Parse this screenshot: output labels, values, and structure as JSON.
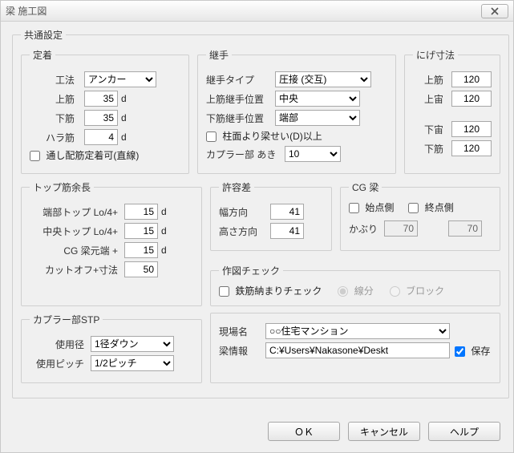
{
  "window": {
    "title": "梁 施工図"
  },
  "common": {
    "legend": "共通設定",
    "fixation": {
      "legend": "定着",
      "method_label": "工法",
      "method_value": "アンカー",
      "upper_label": "上筋",
      "upper_value": "35",
      "upper_unit": "d",
      "lower_label": "下筋",
      "lower_value": "35",
      "lower_unit": "d",
      "hara_label": "ハラ筋",
      "hara_value": "4",
      "hara_unit": "d",
      "through_label": "通し配筋定着可(直線)"
    },
    "joint": {
      "legend": "継手",
      "type_label": "継手タイプ",
      "type_value": "圧接 (交互)",
      "upper_pos_label": "上筋継手位置",
      "upper_pos_value": "中央",
      "lower_pos_label": "下筋継手位置",
      "lower_pos_value": "端部",
      "pillar_label": "柱面より梁せい(D)以上",
      "coupler_label": "カプラー部 あき",
      "coupler_value": "10"
    },
    "nige": {
      "legend": "にげ寸法",
      "upper_label": "上筋",
      "upper_value": "120",
      "upper_air_label": "上宙",
      "upper_air_value": "120",
      "lower_air_label": "下宙",
      "lower_air_value": "120",
      "lower_label": "下筋",
      "lower_value": "120"
    }
  },
  "topsuji": {
    "legend": "トップ筋余長",
    "edge_label": "端部トップ Lo/4+",
    "edge_value": "15",
    "edge_unit": "d",
    "center_label": "中央トップ Lo/4+",
    "center_value": "15",
    "center_unit": "d",
    "cg_label": "CG 梁元端 +",
    "cg_value": "15",
    "cg_unit": "d",
    "cutoff_label": "カットオフ+寸法",
    "cutoff_value": "50"
  },
  "kyoyo": {
    "legend": "許容差",
    "width_label": "幅方向",
    "width_value": "41",
    "height_label": "高さ方向",
    "height_value": "41"
  },
  "cgbeam": {
    "legend": "CG 梁",
    "start_label": "始点側",
    "end_label": "終点側",
    "kaburi_label": "かぶり",
    "kaburi_start": "70",
    "kaburi_end": "70"
  },
  "sakuzu": {
    "legend": "作図チェック",
    "check_label": "鉄筋納まりチェック",
    "radio_line": "線分",
    "radio_block": "ブロック"
  },
  "coupler": {
    "legend": "カプラー部STP",
    "dia_label": "使用径",
    "dia_value": "1径ダウン",
    "pitch_label": "使用ピッチ",
    "pitch_value": "1/2ピッチ"
  },
  "site": {
    "name_label": "現場名",
    "name_value": "○○住宅マンション",
    "info_label": "梁情報",
    "info_value": "C:¥Users¥Nakasone¥Deskt",
    "save_label": "保存"
  },
  "buttons": {
    "ok": "ＯＫ",
    "cancel": "キャンセル",
    "help": "ヘルプ"
  }
}
